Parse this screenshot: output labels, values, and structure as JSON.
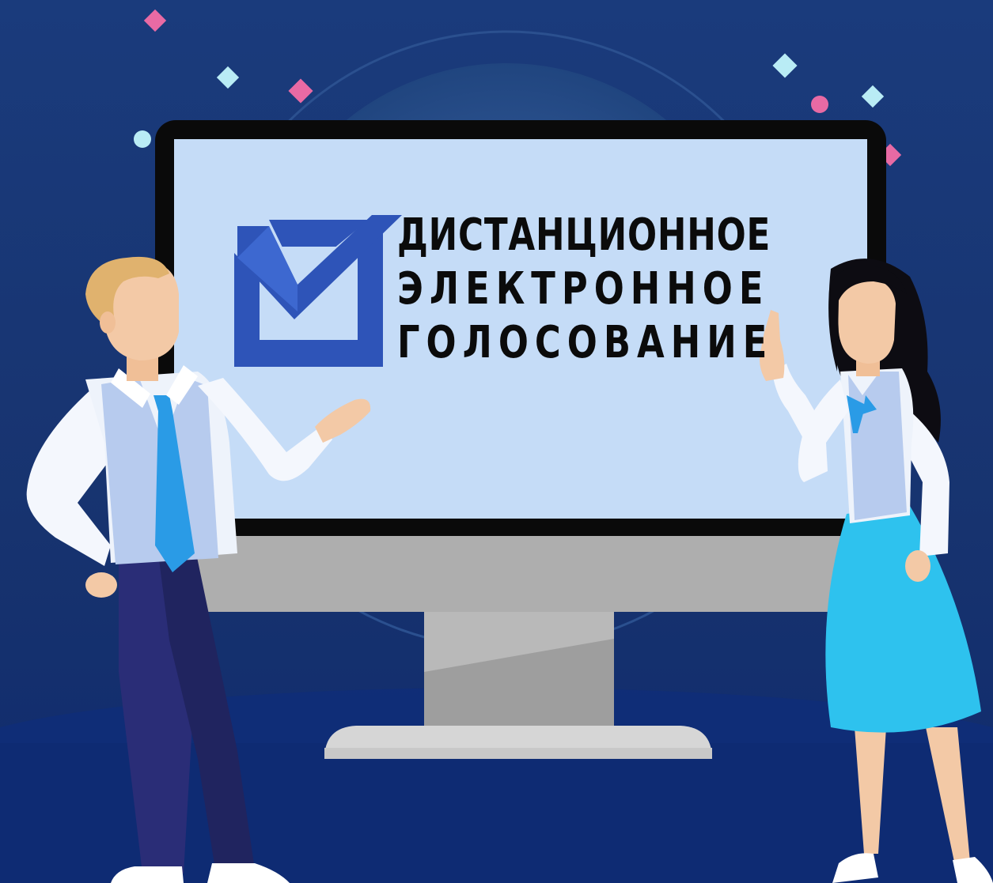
{
  "logo": {
    "line1": "ДИСТАНЦИОННОЕ",
    "line2": "ЭЛЕКТРОННОЕ",
    "line3": "ГОЛОСОВАНИЕ",
    "icon": "checkbox-check-icon"
  },
  "colors": {
    "background_top": "#17377a",
    "background_bottom": "#0e2a6e",
    "screen": "#c5dcf7",
    "monitor_frame": "#0a0a0a",
    "monitor_stand": "#a8a8a8",
    "logo_blue": "#2e54b8",
    "accent_pink": "#e86aa4",
    "accent_cyan": "#b9ecf5",
    "tie_blue": "#2a9be6",
    "skirt_blue": "#2ec2ee"
  }
}
